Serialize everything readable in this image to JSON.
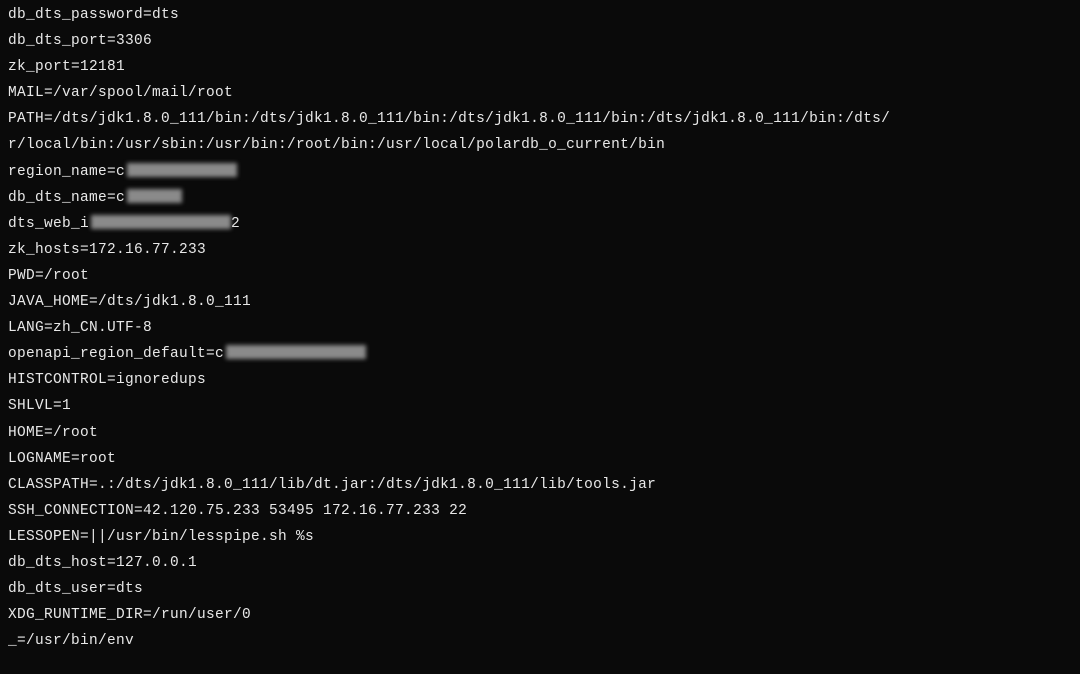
{
  "env": {
    "db_dts_password": "db_dts_password=dts",
    "db_dts_port": "db_dts_port=3306",
    "zk_port": "zk_port=12181",
    "mail": "MAIL=/var/spool/mail/root",
    "path": "PATH=/dts/jdk1.8.0_111/bin:/dts/jdk1.8.0_111/bin:/dts/jdk1.8.0_111/bin:/dts/jdk1.8.0_111/bin:/dts/",
    "path_cont": "r/local/bin:/usr/sbin:/usr/bin:/root/bin:/usr/local/polardb_o_current/bin",
    "region_name_prefix": "region_name=c",
    "db_dts_name_prefix": "db_dts_name=c",
    "dts_web_i_prefix": "dts_web_i",
    "dts_web_i_suffix": "2",
    "zk_hosts": "zk_hosts=172.16.77.233",
    "pwd": "PWD=/root",
    "java_home": "JAVA_HOME=/dts/jdk1.8.0_111",
    "lang": "LANG=zh_CN.UTF-8",
    "openapi_region_default_prefix": "openapi_region_default=c",
    "histcontrol": "HISTCONTROL=ignoredups",
    "shlvl": "SHLVL=1",
    "home": "HOME=/root",
    "logname": "LOGNAME=root",
    "classpath": "CLASSPATH=.:/dts/jdk1.8.0_111/lib/dt.jar:/dts/jdk1.8.0_111/lib/tools.jar",
    "ssh_connection": "SSH_CONNECTION=42.120.75.233 53495 172.16.77.233 22",
    "lessopen": "LESSOPEN=||/usr/bin/lesspipe.sh %s",
    "db_dts_host": "db_dts_host=127.0.0.1",
    "db_dts_user": "db_dts_user=dts",
    "xdg_runtime_dir": "XDG_RUNTIME_DIR=/run/user/0",
    "underscore": "_=/usr/bin/env"
  }
}
